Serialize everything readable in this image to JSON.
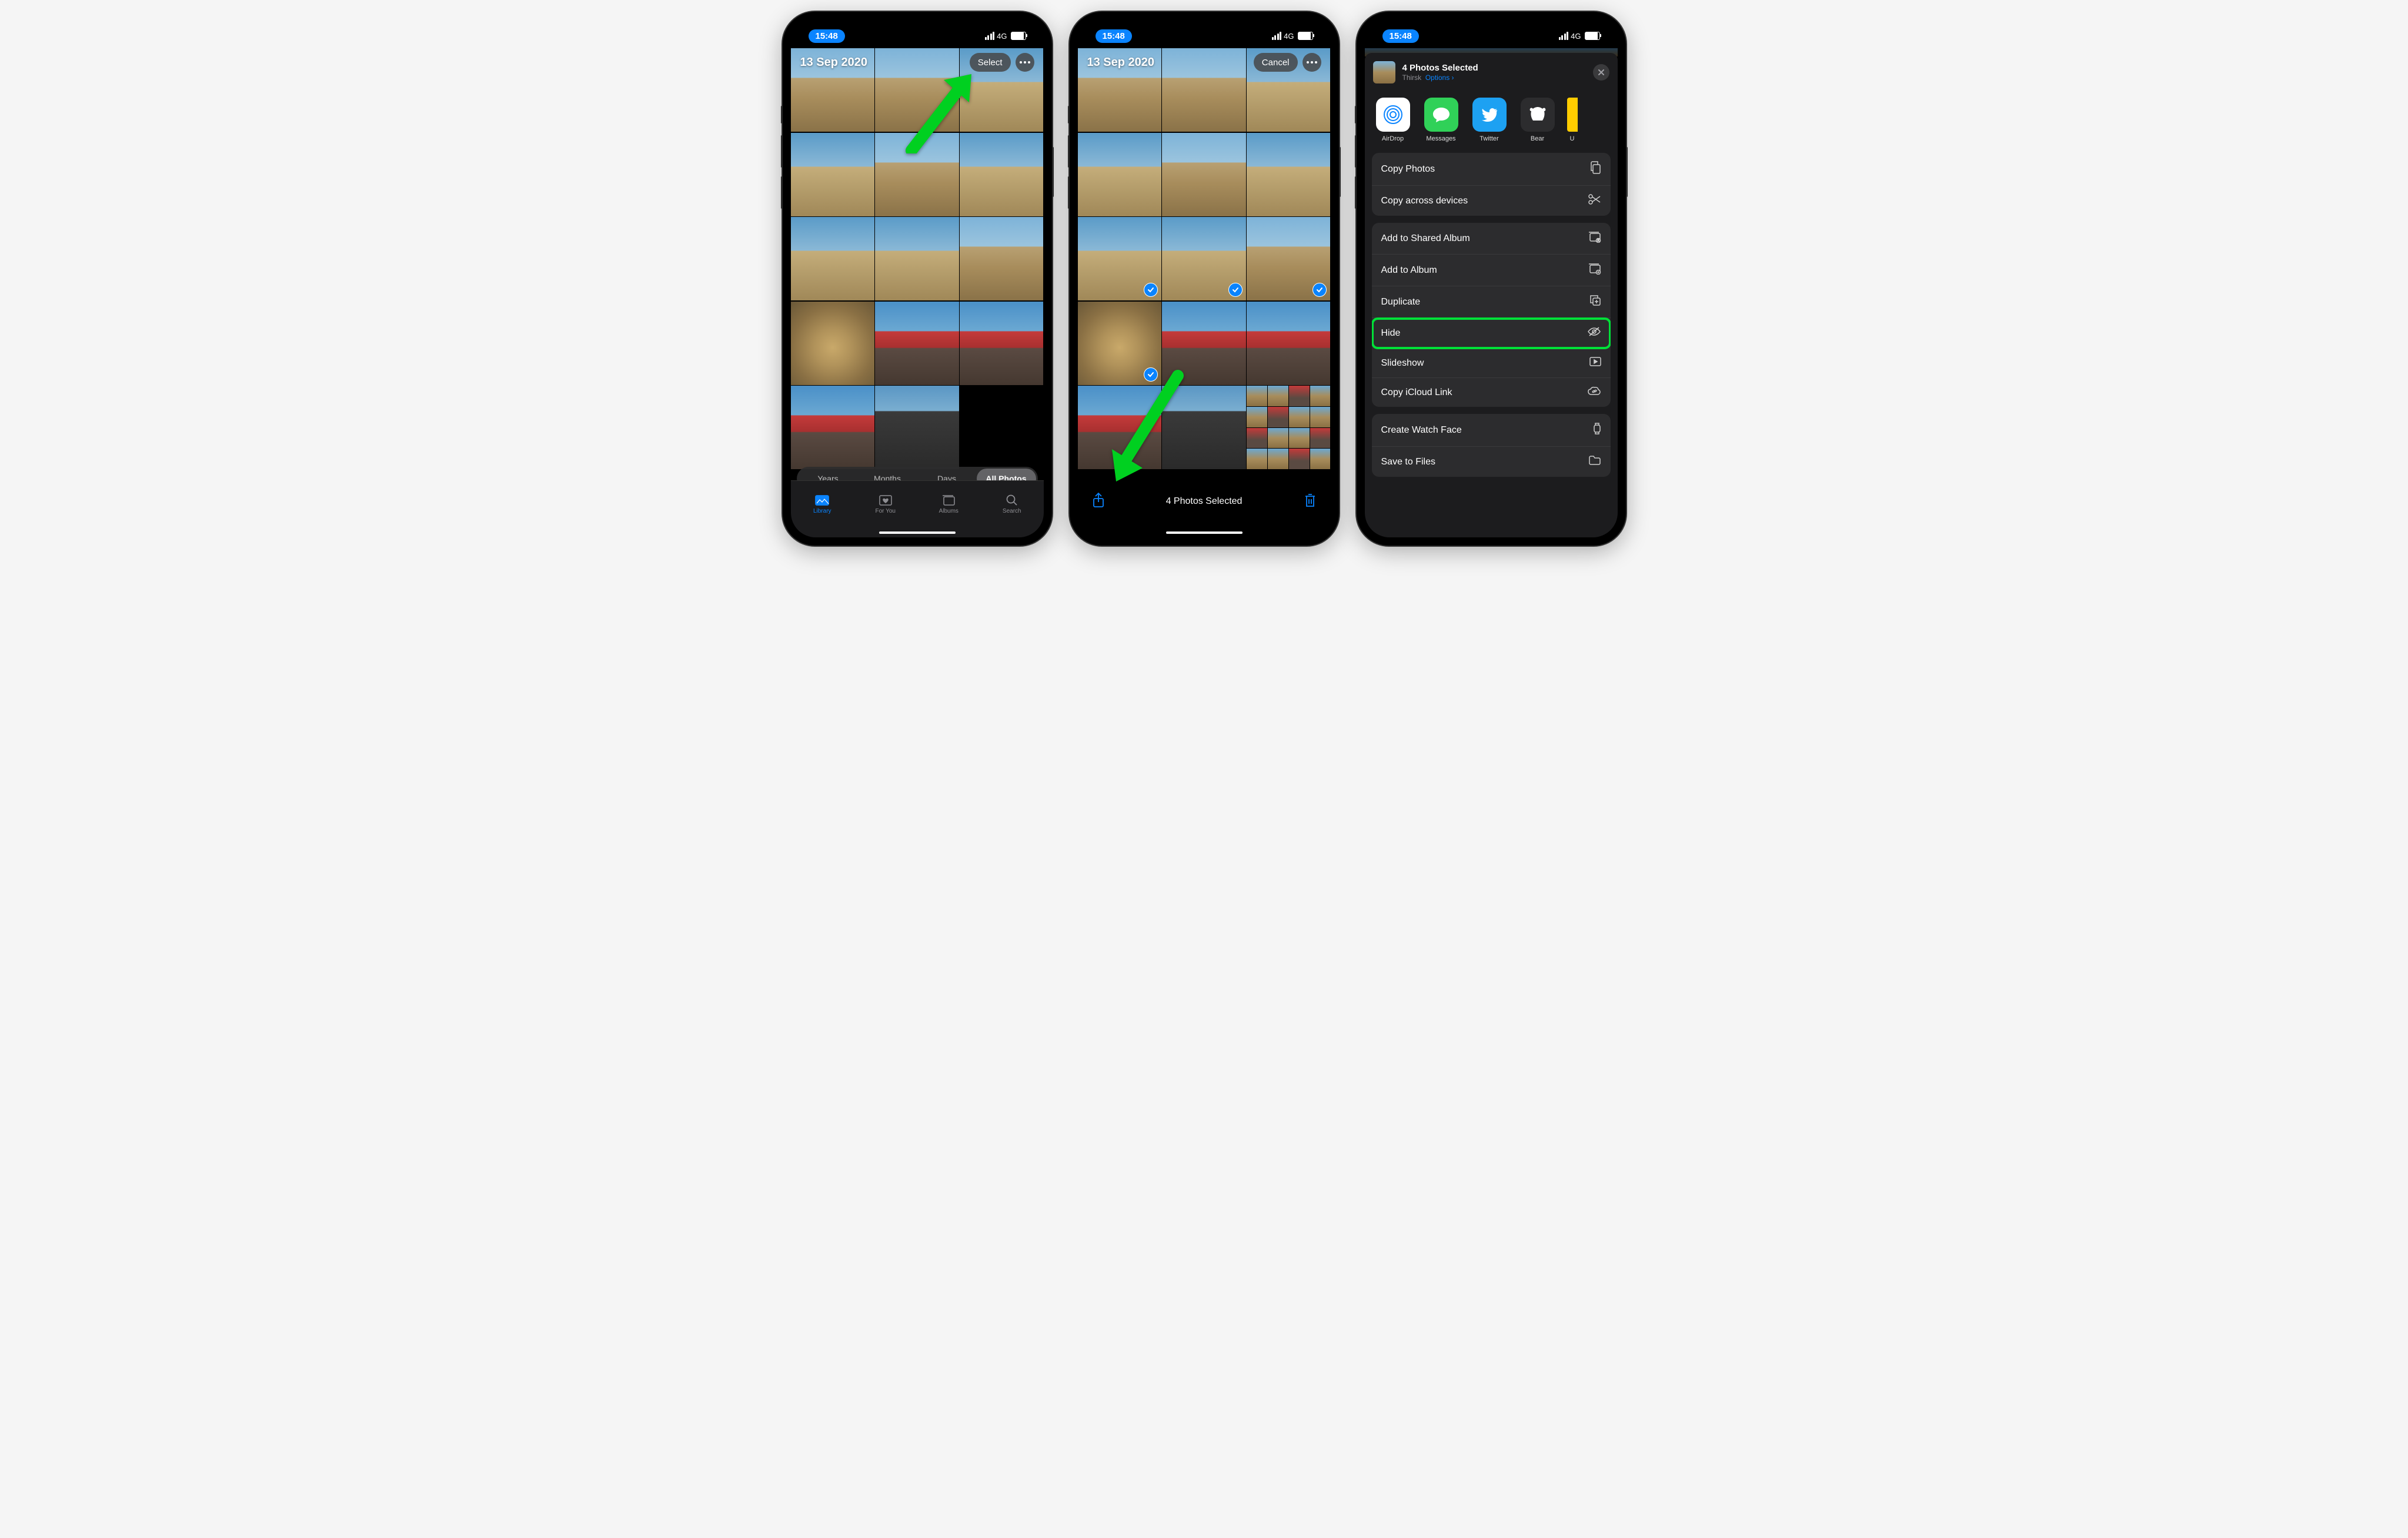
{
  "status": {
    "time": "15:48",
    "network": "4G"
  },
  "phone1": {
    "date_title": "13 Sep 2020",
    "select_btn": "Select",
    "segmented": [
      "Years",
      "Months",
      "Days",
      "All Photos"
    ],
    "segmented_active": 3,
    "tabs": [
      {
        "label": "Library",
        "active": true
      },
      {
        "label": "For You",
        "active": false
      },
      {
        "label": "Albums",
        "active": false
      },
      {
        "label": "Search",
        "active": false
      }
    ]
  },
  "phone2": {
    "date_title": "13 Sep 2020",
    "cancel_btn": "Cancel",
    "selected_text": "4 Photos Selected"
  },
  "phone3": {
    "share_title": "4 Photos Selected",
    "share_location": "Thirsk",
    "options_label": "Options",
    "apps": [
      {
        "label": "AirDrop"
      },
      {
        "label": "Messages"
      },
      {
        "label": "Twitter"
      },
      {
        "label": "Bear"
      }
    ],
    "group1": [
      {
        "label": "Copy Photos",
        "icon": "copy"
      },
      {
        "label": "Copy across devices",
        "icon": "scissors"
      }
    ],
    "group2": [
      {
        "label": "Add to Shared Album",
        "icon": "shared-album"
      },
      {
        "label": "Add to Album",
        "icon": "add-album"
      },
      {
        "label": "Duplicate",
        "icon": "duplicate"
      },
      {
        "label": "Hide",
        "icon": "eye-slash",
        "highlight": true
      },
      {
        "label": "Slideshow",
        "icon": "play"
      },
      {
        "label": "Copy iCloud Link",
        "icon": "cloud-link"
      }
    ],
    "group3": [
      {
        "label": "Create Watch Face",
        "icon": "watch"
      },
      {
        "label": "Save to Files",
        "icon": "folder"
      }
    ]
  }
}
